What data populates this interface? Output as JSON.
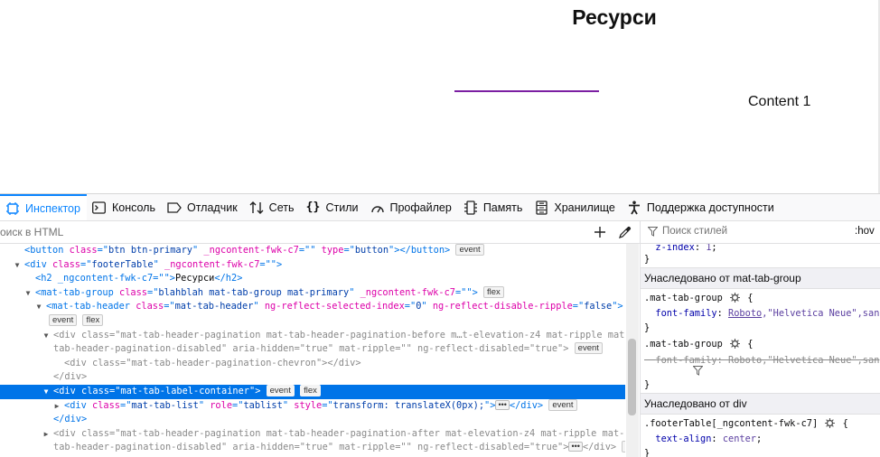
{
  "page": {
    "title": "Ресурси",
    "content": "Content 1",
    "accent": "#7b1fa2"
  },
  "toolbar": {
    "tabs": [
      {
        "label": "Инспектор",
        "icon": "inspector-icon",
        "active": true
      },
      {
        "label": "Консоль",
        "icon": "console-icon"
      },
      {
        "label": "Отладчик",
        "icon": "debugger-icon"
      },
      {
        "label": "Сеть",
        "icon": "network-icon"
      },
      {
        "label": "Стили",
        "icon": "style-editor-icon"
      },
      {
        "label": "Профайлер",
        "icon": "profiler-icon"
      },
      {
        "label": "Память",
        "icon": "memory-icon"
      },
      {
        "label": "Хранилище",
        "icon": "storage-icon"
      },
      {
        "label": "Поддержка доступности",
        "icon": "accessibility-icon"
      }
    ]
  },
  "markup_search": {
    "placeholder": "оиск в HTML"
  },
  "markup": {
    "lines": [
      {
        "button_tag": "button",
        "class_val": "btn btn-primary",
        "attr": "_ngcontent-fwk-c7",
        "type_val": "button",
        "close": "</button>",
        "badge": "event"
      },
      {
        "tag": "div",
        "class_val": "footerTable",
        "attr": "_ngcontent-fwk-c7"
      },
      {
        "h2_open": "<h2 _ngcontent-fwk-c7=\"\">",
        "text": "Ресурси",
        "h2_close": "</h2>"
      },
      {
        "tag": "mat-tab-group",
        "class_val": "blahblah mat-tab-group mat-primary",
        "attr": "_ngcontent-fwk-c7",
        "badge": "flex"
      },
      {
        "tag": "mat-tab-header",
        "class_val": "mat-tab-header",
        "attr1": "ng-reflect-selected-index",
        "val1": "0",
        "attr2": "ng-reflect-disable-ripple",
        "val2": "false",
        "badge1": "event",
        "badge2": "flex"
      },
      {
        "line1": "mat-tab-header-pagination mat-tab-header-pagination-before m…t-elevation-z4 mat-ripple mat-",
        "line2": "tab-header-pagination-disabled",
        "badge": "event"
      },
      {
        "class_val": "mat-tab-header-pagination-chevron"
      },
      {
        "close": "</div>"
      },
      {
        "class_val": "mat-tab-label-container",
        "badge1": "event",
        "badge2": "flex"
      },
      {
        "class_val": "mat-tab-list",
        "role_val": "tablist",
        "style_val": "transform: translateX(0px);",
        "badge": "event"
      },
      {
        "close": "</div>"
      },
      {
        "line1": "mat-tab-header-pagination mat-tab-header-pagination-after mat-elevation-z4 mat-ripple mat-",
        "line2": "tab-header-pagination-disabled",
        "badge": "event"
      }
    ]
  },
  "rules": {
    "filter_placeholder": "Поиск стилей",
    "hov": ":hov",
    "top_prop": "z-index",
    "top_val": "1",
    "inherited_1": "Унаследовано от mat-tab-group",
    "selector_1": ".mat-tab-group",
    "prop_1": "font-family",
    "val_1a": "Roboto",
    "val_1b": ",\"Helvetica Neue\",san",
    "selector_2": ".mat-tab-group",
    "prop_2": "font-family",
    "val_2": "Roboto,\"Helvetica Neue\",san",
    "inherited_2": "Унаследовано от div",
    "selector_3": ".footerTable[_ngcontent-fwk-c7]",
    "prop_3": "text-align",
    "val_3": "center"
  }
}
